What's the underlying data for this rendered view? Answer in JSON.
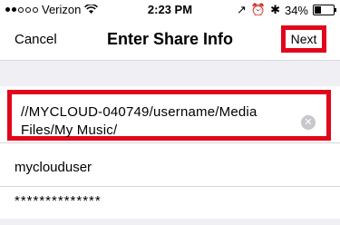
{
  "status_bar": {
    "carrier": "Verizon",
    "time": "2:23 PM",
    "battery": "34%",
    "battery_level": 0.34
  },
  "nav": {
    "cancel_label": "Cancel",
    "title": "Enter Share Info",
    "next_label": "Next"
  },
  "form": {
    "path_value": "//MYCLOUD-040749/username/Media Files/My Music/",
    "username_value": "myclouduser",
    "password_value": "**************"
  },
  "colors": {
    "highlight": "#e1061b",
    "section_bg": "#efeff4"
  },
  "icons": [
    "wifi-icon",
    "location-icon",
    "alarm-icon",
    "bluetooth-icon",
    "battery-icon",
    "clear-icon"
  ]
}
